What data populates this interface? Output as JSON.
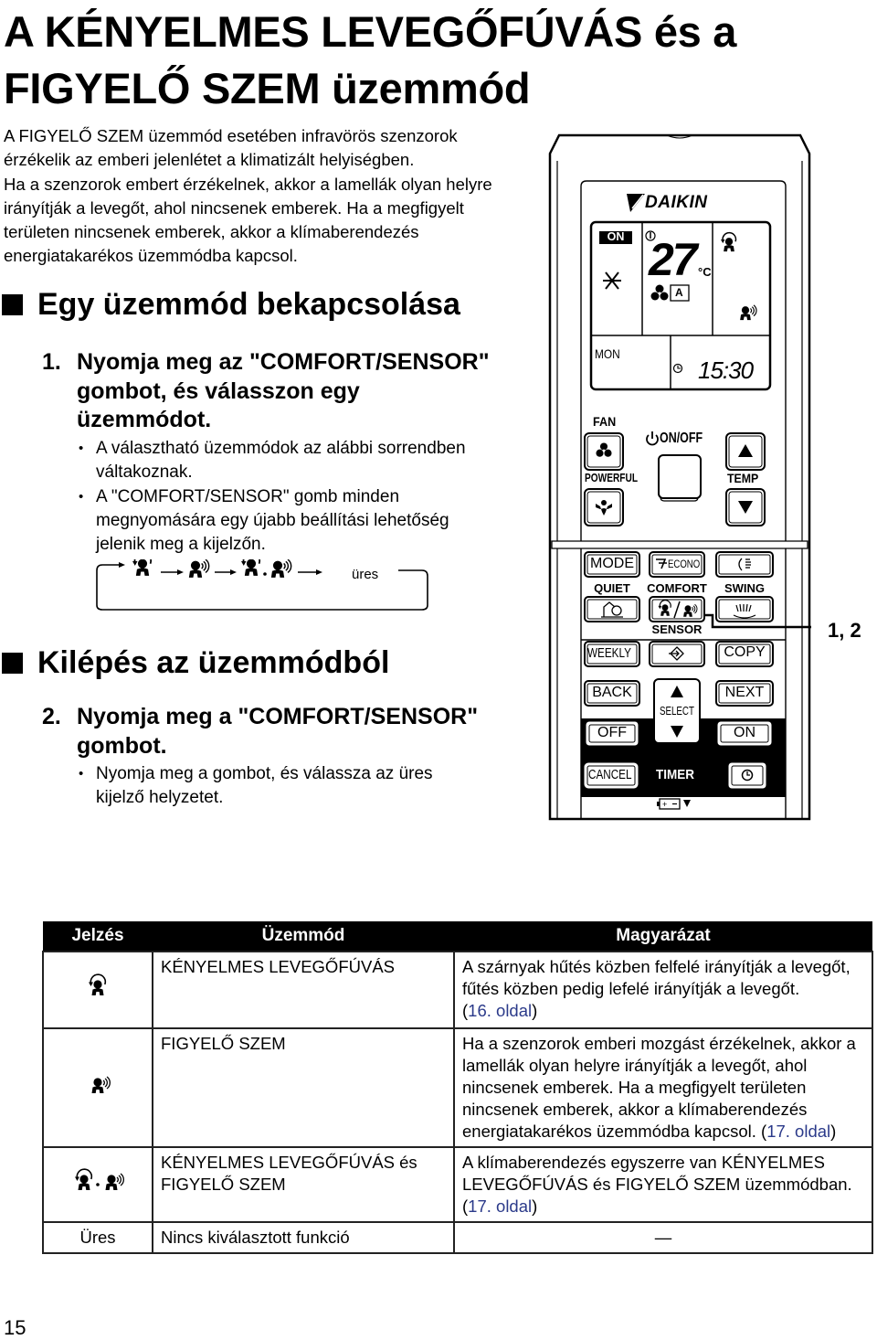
{
  "page": {
    "title_line1": "A KÉNYELMES LEVEGŐFÚVÁS és a",
    "title_line2": "FIGYELŐ SZEM üzemmód",
    "intro": [
      "A FIGYELŐ SZEM üzemmód esetében infravörös szenzorok",
      "érzékelik az emberi jelenlétet a klimatizált helyiségben.",
      "Ha a szenzorok embert érzékelnek, akkor a lamellák olyan helyre",
      "irányítják a levegőt, ahol nincsenek emberek. Ha a megfigyelt",
      "területen nincsenek emberek, akkor a klímaberendezés",
      "energiatakarékos üzemmódba kapcsol."
    ],
    "page_number": "15"
  },
  "section1": {
    "heading": "Egy üzemmód bekapcsolása",
    "step_num": "1.",
    "step_lines": [
      "Nyomja meg az \"COMFORT/SENSOR\"",
      "gombot, és válasszon egy",
      "üzemmódot."
    ],
    "bullets": [
      [
        "A választható üzemmódok az alábbi sorrendben",
        "váltakoznak."
      ],
      [
        "A \"COMFORT/SENSOR\" gomb minden",
        "megnyomására egy újabb beállítási lehetőség",
        "jelenik meg a kijelzőn."
      ]
    ],
    "cycle": {
      "items": [
        "comfort-airflow-icon",
        "intelligent-eye-icon",
        "comfort-and-eye-icon"
      ],
      "blank_label": "üres"
    }
  },
  "section2": {
    "heading": "Kilépés az üzemmódból",
    "step_num": "2.",
    "step_lines": [
      "Nyomja meg a \"COMFORT/SENSOR\"",
      "gombot."
    ],
    "bullets": [
      [
        "Nyomja meg a gombot, és válassza az üres",
        "kijelző helyzetet."
      ]
    ]
  },
  "remote": {
    "brand": "DAIKIN",
    "lcd": {
      "on_badge": "ON",
      "temperature": "27",
      "unit": "°C",
      "fan_mode": "A",
      "day": "MON",
      "time": "15:30"
    },
    "buttons": {
      "fan": "FAN",
      "on_off": "ON/OFF",
      "powerful": "POWERFUL",
      "temp": "TEMP",
      "mode": "MODE",
      "econo": "ECONO",
      "quiet": "QUIET",
      "comfort": "COMFORT",
      "swing": "SWING",
      "sensor": "SENSOR",
      "weekly": "WEEKLY",
      "copy": "COPY",
      "back": "BACK",
      "next": "NEXT",
      "select": "SELECT",
      "off": "OFF",
      "on": "ON",
      "cancel": "CANCEL",
      "timer": "TIMER"
    },
    "callout": "1, 2"
  },
  "table": {
    "headers": [
      "Jelzés",
      "Üzemmód",
      "Magyarázat"
    ],
    "rows": [
      {
        "symbol": "comfort-airflow-icon",
        "mode": "KÉNYELMES LEVEGŐFÚVÁS",
        "desc": "A szárnyak hűtés közben felfelé irányítják a levegőt, fűtés közben pedig lefelé irányítják a levegőt.",
        "ref_open": "(",
        "ref": "16. oldal",
        "ref_close": ")"
      },
      {
        "symbol": "intelligent-eye-icon",
        "mode": "FIGYELŐ SZEM",
        "desc": "Ha a szenzorok emberi mozgást érzékelnek, akkor a lamellák olyan helyre irányítják a levegőt, ahol nincsenek emberek. Ha a megfigyelt területen nincsenek emberek, akkor a klímaberendezés energiatakarékos üzemmódba kapcsol. ",
        "ref_open": "(",
        "ref": "17. oldal",
        "ref_close": ")"
      },
      {
        "symbol": "comfort-and-eye-icon",
        "mode": "KÉNYELMES LEVEGŐFÚVÁS és FIGYELŐ SZEM",
        "desc": "A klímaberendezés egyszerre van KÉNYELMES LEVEGŐFÚVÁS és FIGYELŐ SZEM üzemmódban.",
        "ref_open": "(",
        "ref": "17. oldal",
        "ref_close": ")"
      },
      {
        "symbol_text": "Üres",
        "mode": "Nincs kiválasztott funkció",
        "desc": "—"
      }
    ]
  },
  "colors": {
    "link": "#2b3a8a",
    "header_bg": "#000000"
  }
}
